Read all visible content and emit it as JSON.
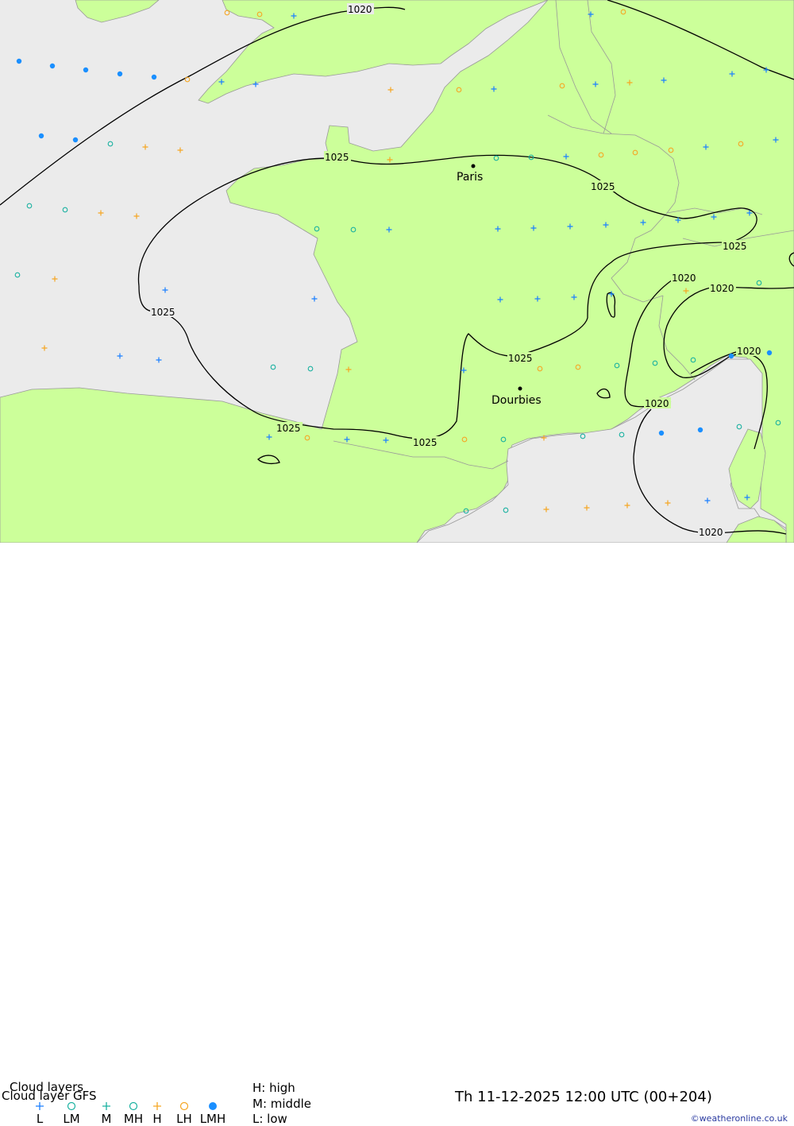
{
  "map": {
    "title_left": "Cloud layers",
    "title_left_overlay": "Cloud layer   GFS",
    "datetime": "Th 11-12-2025 12:00 UTC (00+204)",
    "copyright": "©weatheronline.co.uk",
    "colors": {
      "land": "#ccff9a",
      "sea": "#ebebeb",
      "border": "#999999",
      "isobar": "#000000",
      "low": "#1a7fff",
      "lowmid": "#19b1a0",
      "high": "#f5a623",
      "lmh_dot": "#1a8fff"
    },
    "cities": [
      {
        "name": "Paris"
      },
      {
        "name": "Dourbies"
      }
    ],
    "isobar_labels": [
      "1020",
      "1025",
      "1025",
      "1025",
      "1025",
      "1025",
      "1025",
      "1020",
      "1020",
      "1020",
      "1020",
      "1025",
      "1020"
    ]
  },
  "legend": {
    "symbols": [
      {
        "label": "L",
        "icon": "plus-icon",
        "color": "#1a7fff"
      },
      {
        "label": "LM",
        "icon": "circle-icon",
        "color": "#19b1a0"
      },
      {
        "label": "M",
        "icon": "plus-icon",
        "color": "#19b1a0"
      },
      {
        "label": "MH",
        "icon": "circle-icon",
        "color": "#19b1a0"
      },
      {
        "label": "H",
        "icon": "plus-icon",
        "color": "#f5a623"
      },
      {
        "label": "LH",
        "icon": "circle-icon",
        "color": "#f5a623"
      },
      {
        "label": "LMH",
        "icon": "dot-icon",
        "color": "#1a8fff"
      }
    ],
    "key": [
      {
        "text": "H:  high"
      },
      {
        "text": "M:  middle"
      },
      {
        "text": "L:  low"
      }
    ]
  }
}
